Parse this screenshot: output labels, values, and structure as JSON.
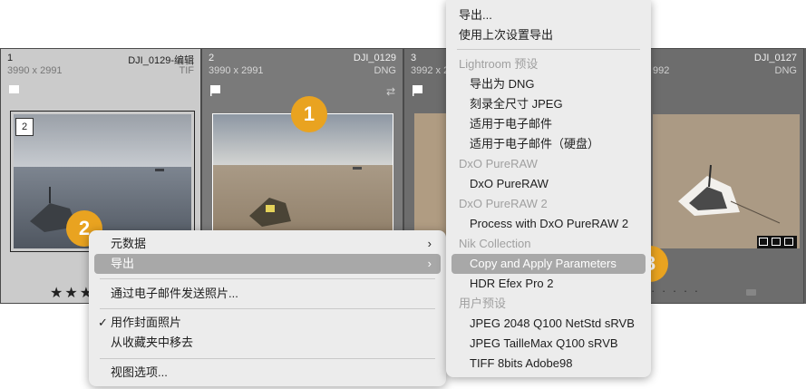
{
  "cells": [
    {
      "num": "1",
      "name": "DJI_0129-编辑",
      "dims": "3990 x 2991",
      "ext": "TIF",
      "badge": "2"
    },
    {
      "num": "2",
      "name": "DJI_0129",
      "dims": "3990 x 2991",
      "ext": "DNG"
    },
    {
      "num": "3",
      "dims": "3992 x 2"
    },
    {
      "name": "DJI_0127",
      "dims": "992",
      "ext": "DNG"
    }
  ],
  "rating": "★★★",
  "dots": "· · · · ·",
  "callouts": [
    "1",
    "2",
    "3"
  ],
  "context_menu": {
    "items": [
      {
        "label": "元数据",
        "submenu": true
      },
      {
        "label": "导出",
        "submenu": true,
        "highlighted": true
      },
      {
        "label": "通过电子邮件发送照片..."
      },
      {
        "label": "用作封面照片",
        "checked": true
      },
      {
        "label": "从收藏夹中移去"
      },
      {
        "label": "视图选项..."
      }
    ]
  },
  "export_menu": {
    "items": [
      {
        "label": "导出..."
      },
      {
        "label": "使用上次设置导出"
      },
      {
        "label": "Lightroom 预设",
        "header": true
      },
      {
        "label": "导出为 DNG"
      },
      {
        "label": "刻录全尺寸 JPEG"
      },
      {
        "label": "适用于电子邮件"
      },
      {
        "label": "适用于电子邮件（硬盘）"
      },
      {
        "label": "DxO PureRAW",
        "header": true
      },
      {
        "label": "DxO PureRAW"
      },
      {
        "label": "DxO PureRAW 2",
        "header": true
      },
      {
        "label": "Process with DxO PureRAW 2"
      },
      {
        "label": "Nik Collection",
        "header": true
      },
      {
        "label": "Copy and Apply Parameters",
        "highlighted": true
      },
      {
        "label": "HDR Efex Pro 2"
      },
      {
        "label": "用户预设",
        "header": true
      },
      {
        "label": "JPEG 2048 Q100 NetStd sRVB"
      },
      {
        "label": "JPEG TailleMax Q100 sRVB"
      },
      {
        "label": "TIFF 8bits Adobe98"
      }
    ]
  }
}
